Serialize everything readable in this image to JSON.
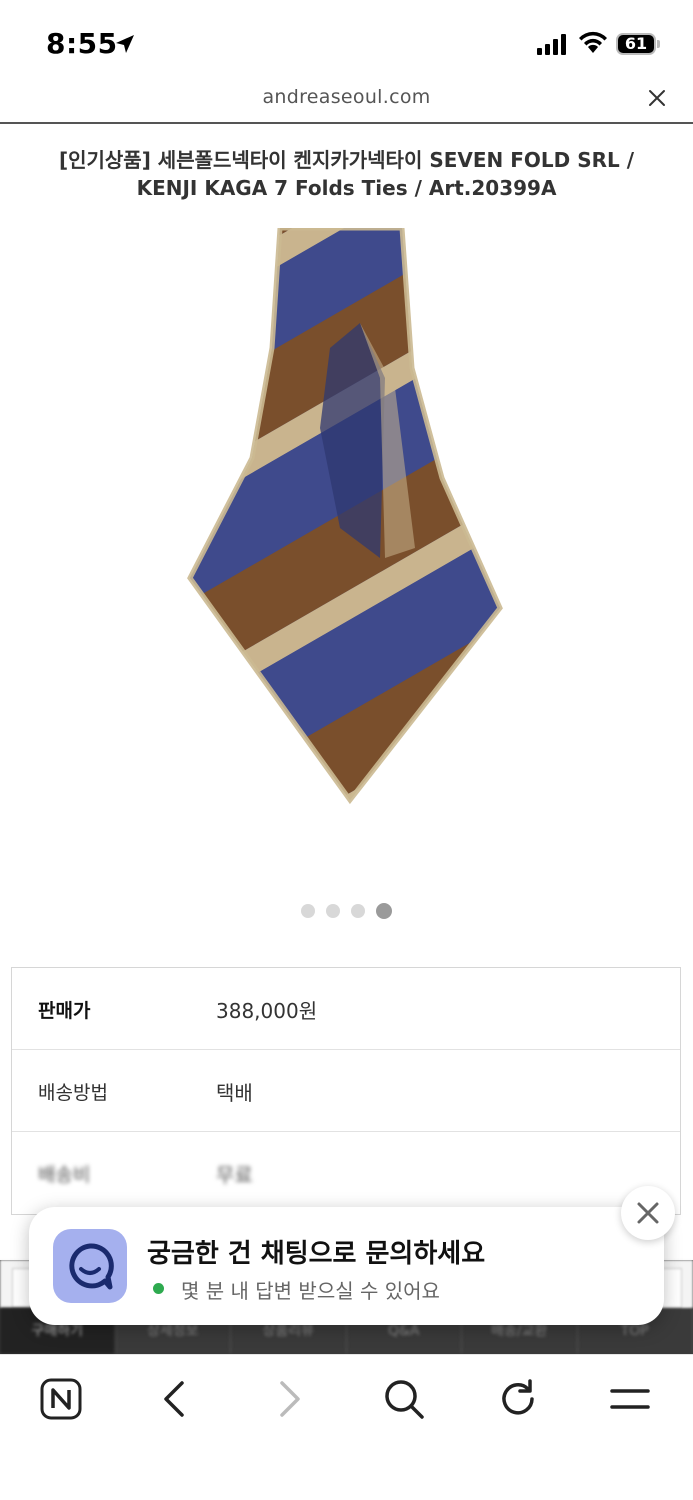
{
  "status_bar": {
    "time": "8:55",
    "battery": "61",
    "icons": [
      "location-arrow-icon",
      "signal-bars-icon",
      "wifi-icon",
      "battery-icon"
    ]
  },
  "browser": {
    "url": "andreaseoul.com"
  },
  "product": {
    "title": "[인기상품] 세븐폴드넥타이 켄지카가넥타이 SEVEN FOLD SRL / KENJI KAGA 7 Folds Ties / Art.20399A",
    "carousel": {
      "total": 4,
      "active": 4
    }
  },
  "info": {
    "rows": [
      {
        "label": "판매가",
        "value": "388,000원"
      },
      {
        "label": "배송방법",
        "value": "택배"
      },
      {
        "label": "배송비",
        "value": "무료"
      }
    ]
  },
  "tab_strip": {
    "tabs": [
      "구매하기",
      "상세정보",
      "상품리뷰",
      "Q&A",
      "배송/교환",
      "TOP"
    ]
  },
  "chat": {
    "title": "궁금한 건 채팅으로 문의하세요",
    "subtitle": "몇 분 내 답변 받으실 수 있어요",
    "status_color": "#2eaa4f",
    "icon_color": "#a5b0ee"
  },
  "bottom_nav": {
    "icons": [
      "naver-n-icon",
      "back-arrow-icon",
      "forward-arrow-icon",
      "search-icon",
      "refresh-icon",
      "menu-icon"
    ]
  }
}
